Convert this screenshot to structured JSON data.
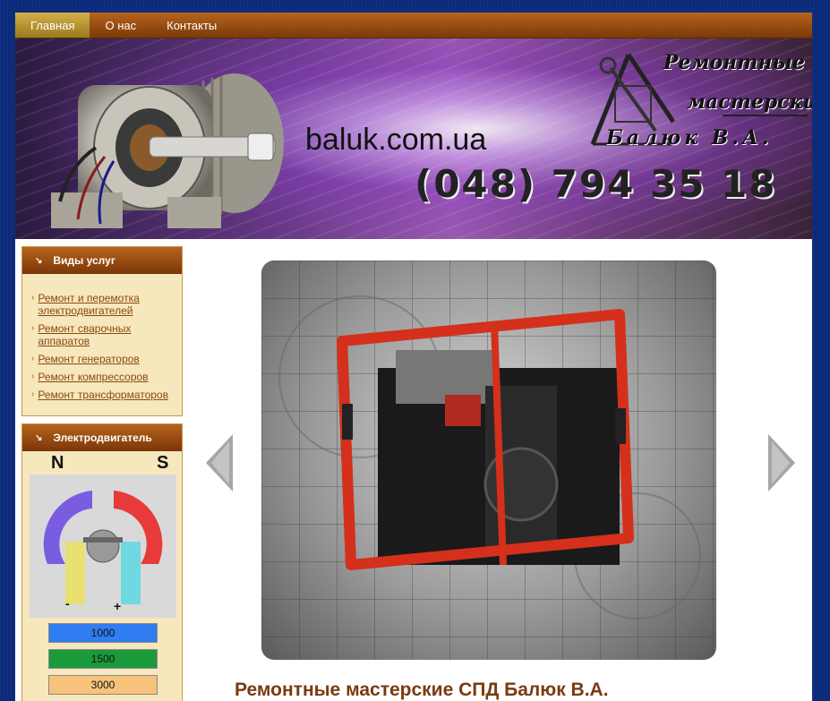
{
  "nav": {
    "items": [
      {
        "label": "Главная",
        "active": true
      },
      {
        "label": "О нас",
        "active": false
      },
      {
        "label": "Контакты",
        "active": false
      }
    ]
  },
  "banner": {
    "site_url": "baluk.com.ua",
    "phone": "(048) 794 35 18",
    "logo_line1": "Ремонтные",
    "logo_line2": "мастерские",
    "logo_line3": "Балюк В.А."
  },
  "sidebar": {
    "services": {
      "title": "Виды услуг",
      "items": [
        {
          "label": "Ремонт и перемотка электродвигателей"
        },
        {
          "label": "Ремонт сварочных аппаратов"
        },
        {
          "label": "Ремонт генераторов"
        },
        {
          "label": "Ремонт компрессоров"
        },
        {
          "label": "Ремонт трансформаторов"
        }
      ]
    },
    "motor": {
      "title": "Электродвигатель",
      "pole_n": "N",
      "pole_s": "S",
      "minus": "-",
      "plus": "+",
      "speeds": [
        {
          "label": "1000",
          "color": "#2f7df0"
        },
        {
          "label": "1500",
          "color": "#1a9a3a"
        },
        {
          "label": "3000",
          "color": "#f7c37a"
        }
      ]
    }
  },
  "main": {
    "title": "Ремонтные мастерские СПД Балюк В.А."
  },
  "colors": {
    "nav_brown": "#8a440e",
    "nav_active": "#c09a34",
    "link": "#8a4a10",
    "sidebar_bg": "#f6e7bd"
  }
}
